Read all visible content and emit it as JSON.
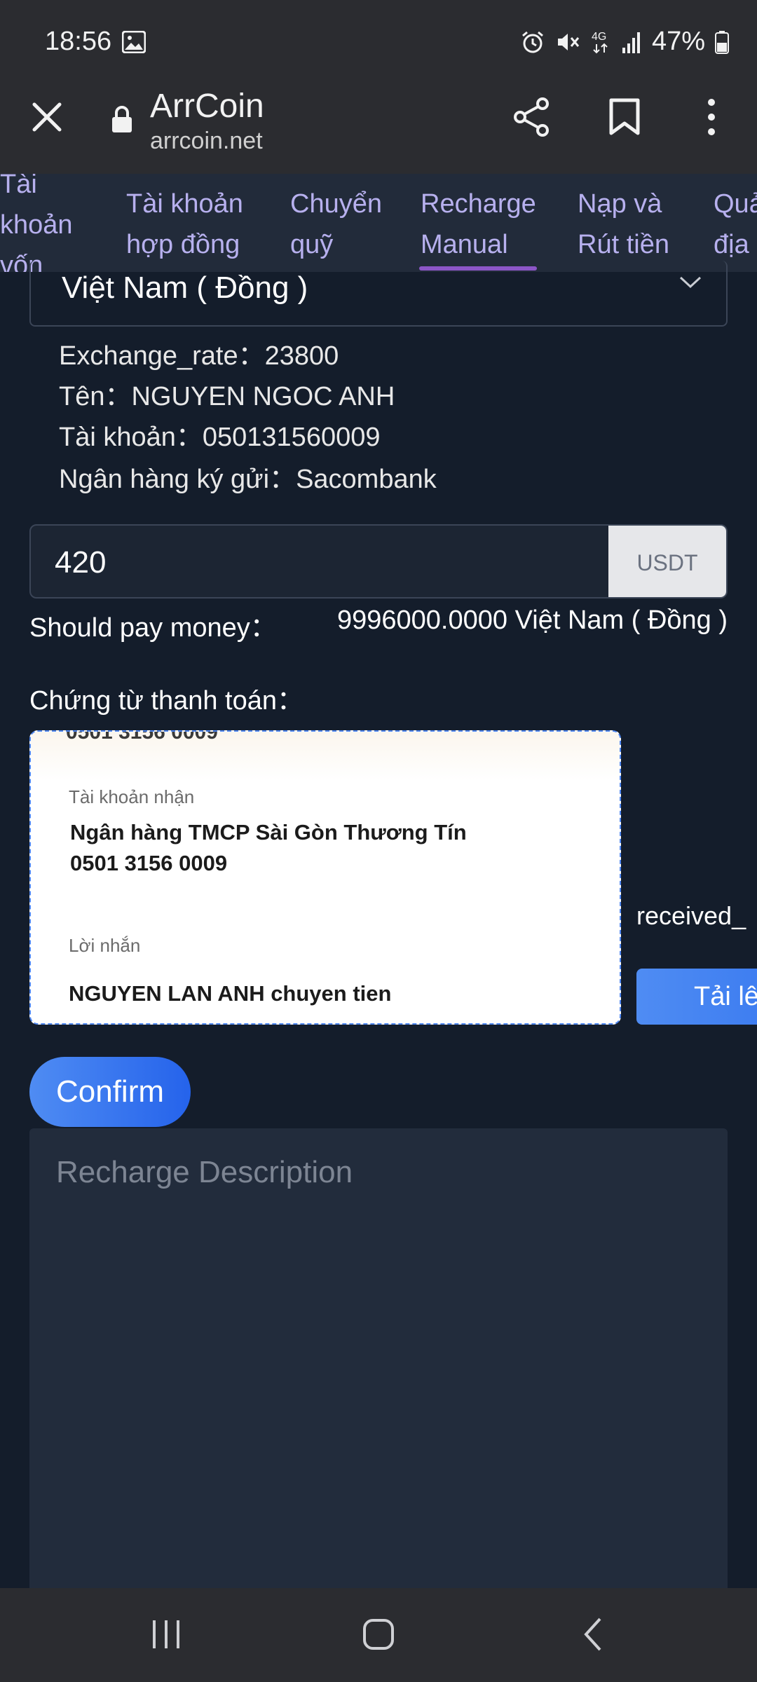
{
  "status_bar": {
    "time": "18:56",
    "battery": "47%",
    "icons": [
      "gallery-icon",
      "alarm-icon",
      "mute-icon",
      "4g-icon",
      "signal-icon",
      "battery-icon"
    ]
  },
  "browser": {
    "title": "ArrCoin",
    "url": "arrcoin.net"
  },
  "tabs": [
    {
      "label_line1": "Tài",
      "label_line2": "khoản",
      "label_line3": "vốn"
    },
    {
      "label_line1": "Tài khoản",
      "label_line2": "hợp đồng"
    },
    {
      "label_line1": "Chuyển",
      "label_line2": "quỹ"
    },
    {
      "label_line1": "Recharge",
      "label_line2": "Manual",
      "active": true
    },
    {
      "label_line1": "Nạp và",
      "label_line2": "Rút tiền"
    },
    {
      "label_line1": "Quả",
      "label_line2": "địa"
    }
  ],
  "form": {
    "currency": "Việt Nam ( Đồng )",
    "exchange_rate": "Exchange_rate：23800",
    "name": "Tên：NGUYEN NGOC ANH",
    "account": "Tài khoản：050131560009",
    "bank": "Ngân hàng ký gửi：Sacombank",
    "amount": "420",
    "amount_unit": "USDT",
    "should_pay_label": "Should pay money：",
    "should_pay_value": "9996000.0000 Việt Nam ( Đồng )",
    "voucher_label": "Chứng từ thanh toán：",
    "received_filename": "received_",
    "upload_label": "Tải lê",
    "confirm_label": "Confirm",
    "description_placeholder": "Recharge Description"
  },
  "receipt_image": {
    "cut_top": "0501 3156 0009",
    "receiver_label": "Tài khoản nhận",
    "receiver_bank": "Ngân hàng TMCP Sài Gòn Thương Tín",
    "receiver_account": "0501 3156 0009",
    "message_label": "Lời nhắn",
    "message": "NGUYEN LAN ANH  chuyen tien"
  }
}
